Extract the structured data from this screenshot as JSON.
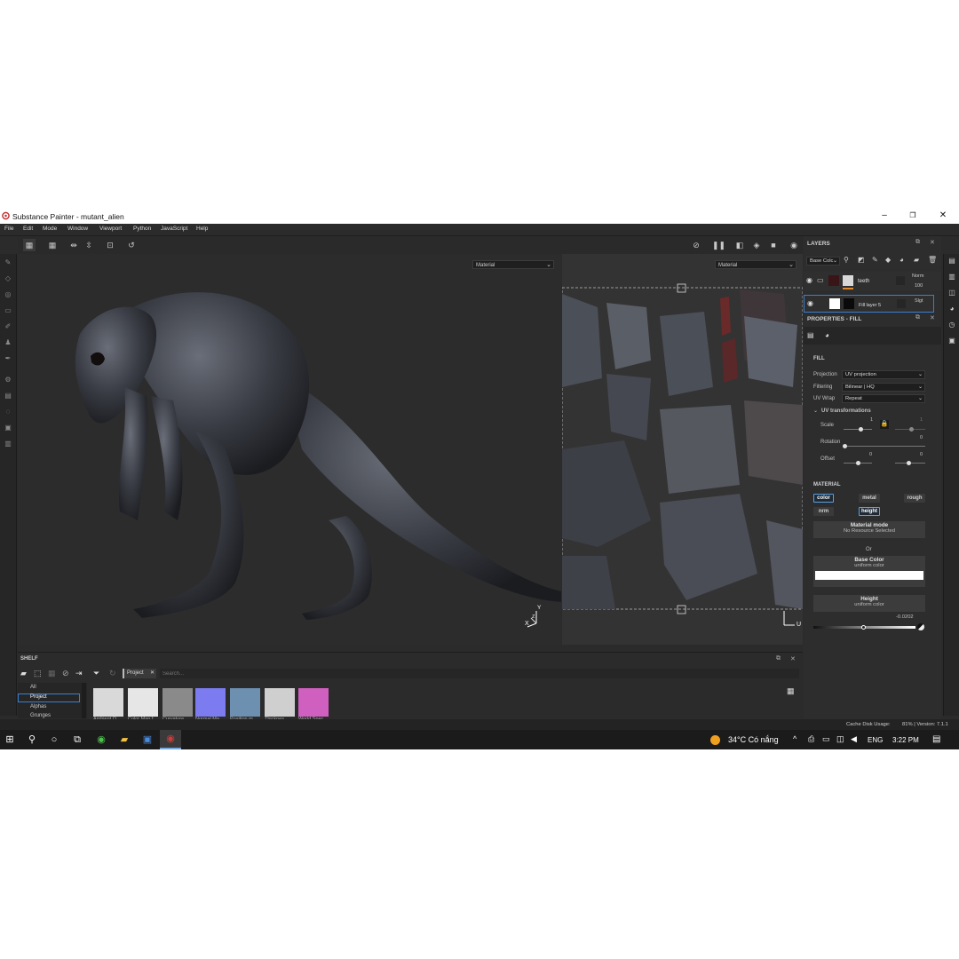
{
  "window": {
    "title": "Substance Painter - mutant_alien",
    "minimize": "–",
    "maximize": "❐",
    "close": "✕"
  },
  "menu": [
    "File",
    "Edit",
    "Mode",
    "Window",
    "Viewport",
    "Python",
    "JavaScript",
    "Help"
  ],
  "viewport3d": {
    "mode": "Material",
    "axis_x": "X",
    "axis_y": "Y",
    "axis_z": "Z"
  },
  "viewport2d": {
    "mode": "Material",
    "axis_u": "U"
  },
  "layers": {
    "header": "LAYERS",
    "channel": "Base Colc",
    "rows": [
      {
        "name": "teeth",
        "blend": "Norm",
        "opacity": "100"
      },
      {
        "name": "Fill layer 5",
        "blend": "Slgt"
      }
    ]
  },
  "properties": {
    "header": "PROPERTIES - FILL",
    "fill_title": "FILL",
    "projection_label": "Projection",
    "projection_value": "UV projection",
    "filtering_label": "Filtering",
    "filtering_value": "Bilinear | HQ",
    "uvwrap_label": "UV Wrap",
    "uvwrap_value": "Repeat",
    "uvtrans_title": "UV transformations",
    "scale_label": "Scale",
    "scale_value": "1",
    "scale_value2": "1",
    "rotation_label": "Rotation",
    "rotation_value": "0",
    "offset_label": "Offset",
    "offset_value1": "0",
    "offset_value2": "0",
    "material_title": "MATERIAL",
    "chips": [
      {
        "label": "color",
        "active": true
      },
      {
        "label": "metal",
        "active": false
      },
      {
        "label": "rough",
        "active": false
      },
      {
        "label": "nrm",
        "active": false
      },
      {
        "label": "height",
        "active": true
      }
    ],
    "material_mode_title": "Material mode",
    "material_mode_sub": "No Resource Selected",
    "or_text": "Or",
    "base_color_title": "Base Color",
    "base_color_sub": "uniform color",
    "base_color_hex": "#ffffff",
    "height_title": "Height",
    "height_sub": "uniform color",
    "height_value": "-0.0202"
  },
  "shelf": {
    "header": "SHELF",
    "tab": "Project",
    "search_placeholder": "Search...",
    "categories": [
      "All",
      "Project",
      "Alphas",
      "Grunges"
    ],
    "selected_category": "Project",
    "items": [
      {
        "label": "Ambient O",
        "color": "#d9d9d9"
      },
      {
        "label": "Color Map f",
        "color": "#e6e6e6"
      },
      {
        "label": "Curvature",
        "color": "#8a8a8a"
      },
      {
        "label": "Normal Ma",
        "color": "#7c7cf0"
      },
      {
        "label": "Position m",
        "color": "#6d8fb0"
      },
      {
        "label": "Thicknes",
        "color": "#cfcfcf"
      },
      {
        "label": "World Spac",
        "color": "#d060c0"
      }
    ]
  },
  "status": {
    "cache_label": "Cache Disk Usage:",
    "cache_value": "81% | Version: 7.1.1"
  },
  "taskbar": {
    "weather": "34°C  Có nắng",
    "language": "ENG",
    "time": "3:22 PM"
  },
  "colors": {
    "accent": "#5aa0e0",
    "brand_red": "#d23a3a",
    "panel": "#2d2d2d"
  }
}
